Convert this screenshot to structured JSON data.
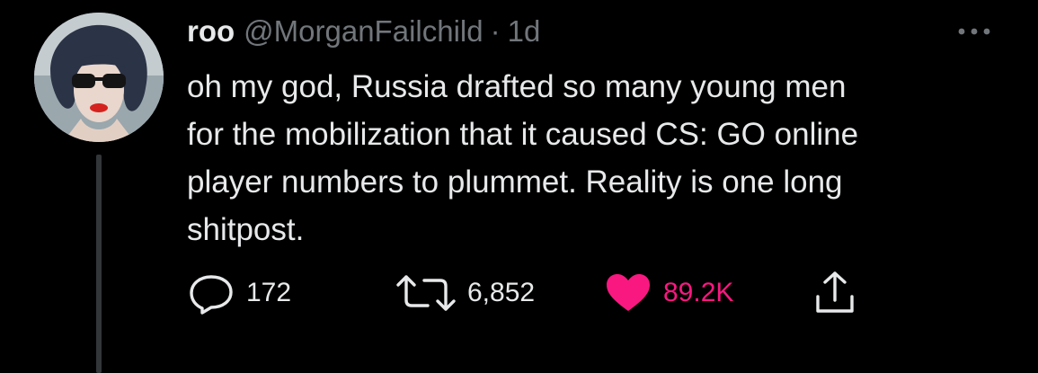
{
  "author": {
    "display_name": "roo",
    "handle": "@MorganFailchild"
  },
  "separator": "·",
  "timestamp": "1d",
  "menu": {
    "icon": "more-horizontal-icon"
  },
  "tweet": {
    "text_lines": [
      "oh my god, Russia drafted so many young men",
      "for the mobilization that it caused CS: GO online",
      "player numbers to plummet. Reality is one long",
      "shitpost."
    ]
  },
  "actions": {
    "reply": {
      "icon": "reply-icon",
      "count": "172"
    },
    "retweet": {
      "icon": "retweet-icon",
      "count": "6,852"
    },
    "like": {
      "icon": "heart-icon",
      "count": "89.2K",
      "liked": true
    },
    "share": {
      "icon": "share-icon"
    }
  },
  "colors": {
    "background": "#000000",
    "text": "#e7e9ea",
    "secondary": "#71767b",
    "like": "#f91880",
    "thread_line": "#333639"
  }
}
